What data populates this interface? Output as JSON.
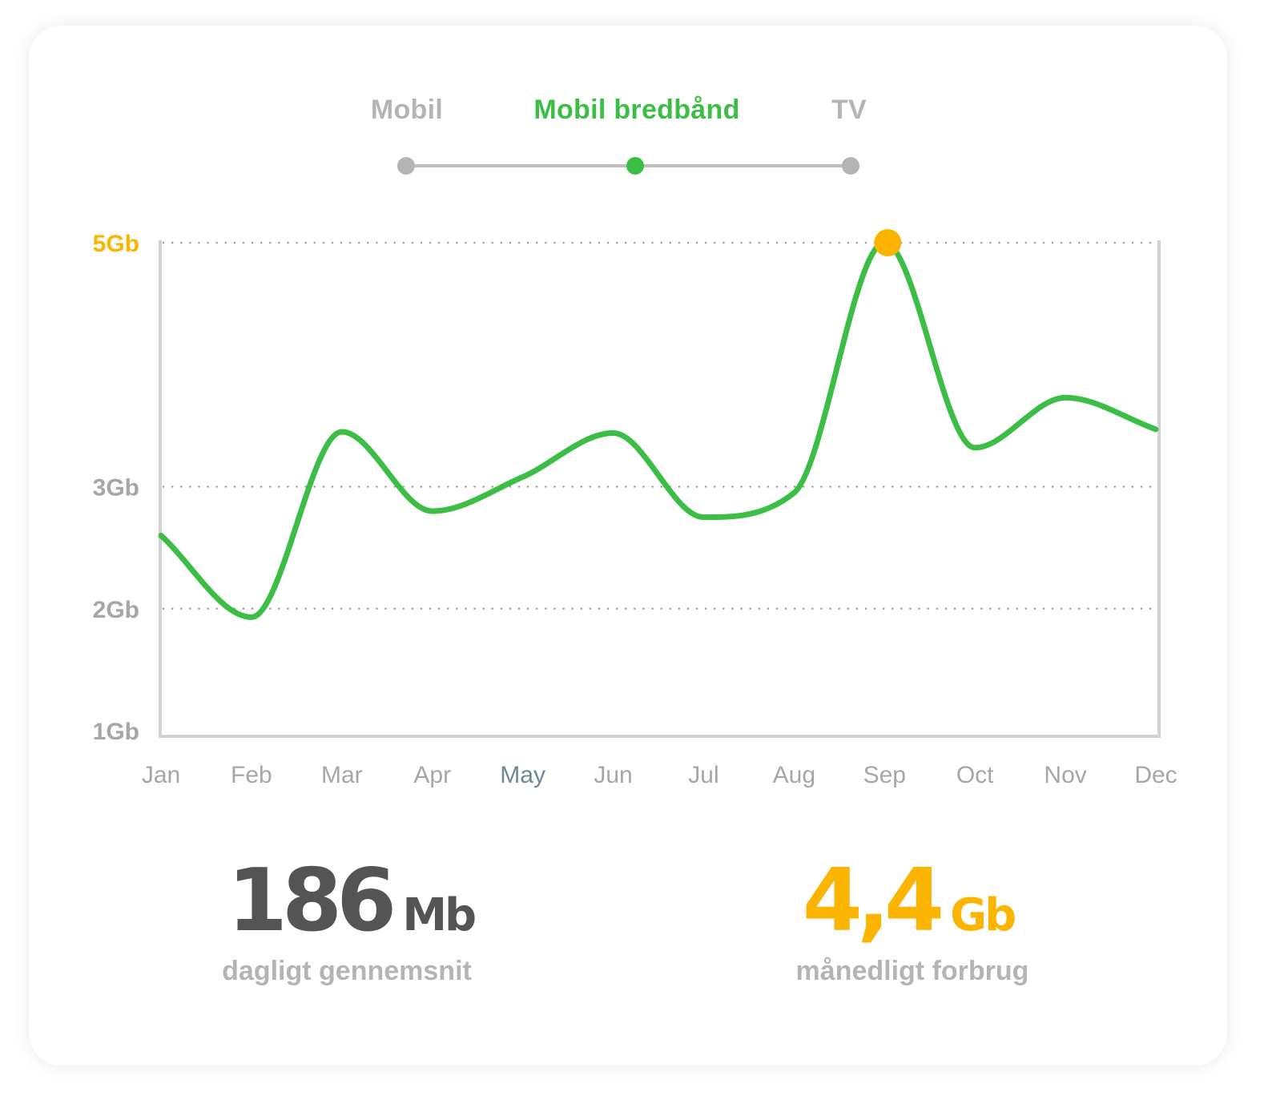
{
  "tabs": {
    "items": [
      {
        "label": "Mobil",
        "active": false
      },
      {
        "label": "Mobil bredbånd",
        "active": true
      },
      {
        "label": "TV",
        "active": false
      }
    ]
  },
  "colors": {
    "accent": "#3cbe46",
    "highlight": "#fbb500",
    "inactive": "#b4b4b4",
    "axis": "#d2d2d2",
    "tick_text": "#a6a6a6",
    "dark_text": "#545454",
    "highlighted_month": "#6d8796"
  },
  "chart_data": {
    "type": "line",
    "categories": [
      "Jan",
      "Feb",
      "Mar",
      "Apr",
      "May",
      "Jun",
      "Jul",
      "Aug",
      "Sep",
      "Oct",
      "Nov",
      "Dec"
    ],
    "series": [
      {
        "values": [
          2.6,
          1.93,
          3.45,
          2.8,
          3.08,
          3.44,
          2.75,
          2.95,
          5.0,
          3.32,
          3.73,
          3.47
        ]
      }
    ],
    "yticks": [
      "1Gb",
      "2Gb",
      "3Gb",
      "5Gb"
    ],
    "ylim": [
      1,
      5
    ],
    "grid": "dotted at 2Gb, 3Gb, 5Gb",
    "highlight": {
      "category": "Sep",
      "value": 5.0,
      "tick": "5Gb"
    }
  },
  "stats": {
    "daily": {
      "value": "186",
      "unit": "Mb",
      "label": "dagligt gennemsnit"
    },
    "monthly": {
      "value": "4,4",
      "unit": "Gb",
      "label": "månedligt forbrug"
    }
  }
}
